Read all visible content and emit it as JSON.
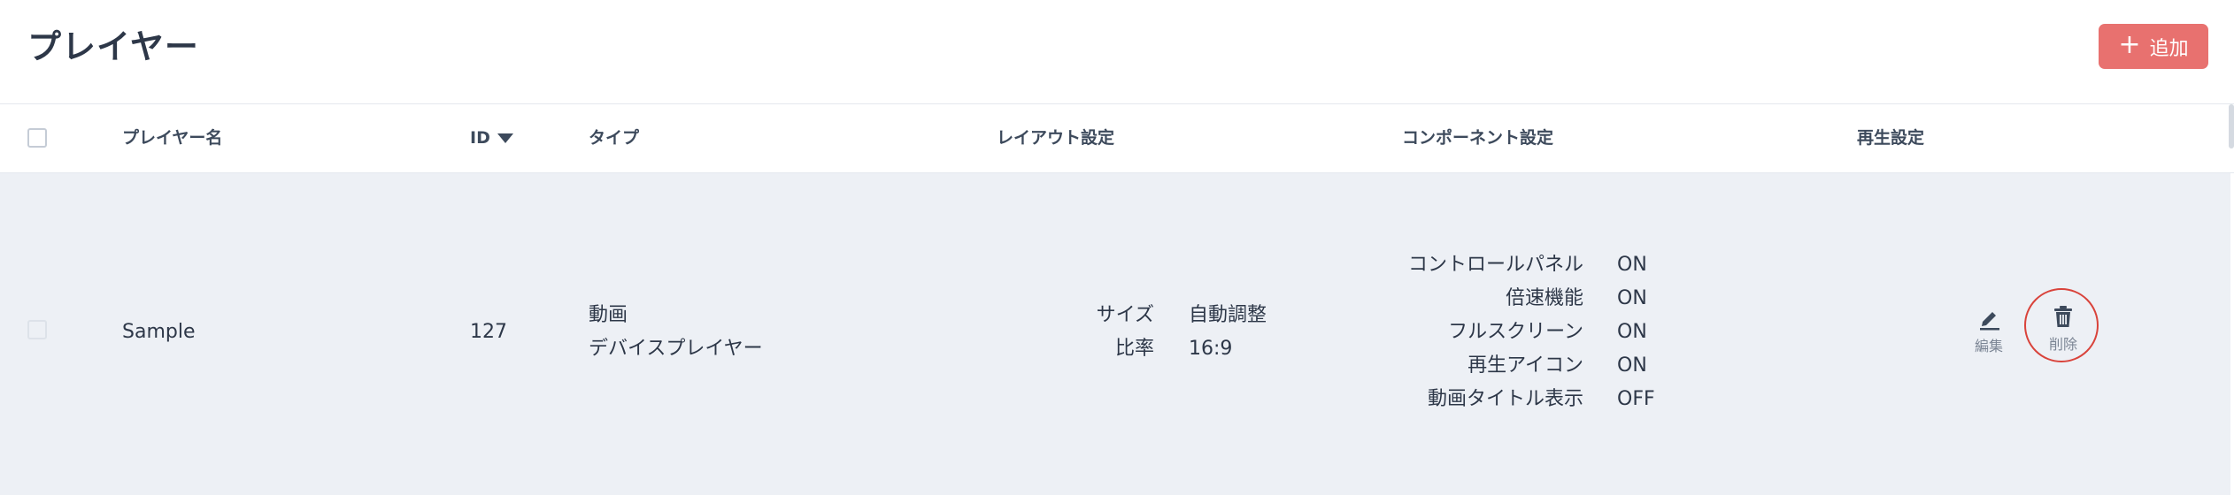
{
  "header": {
    "title": "プレイヤー",
    "add_button_label": "追加"
  },
  "table": {
    "columns": {
      "name": "プレイヤー名",
      "id": "ID",
      "type": "タイプ",
      "layout": "レイアウト設定",
      "component": "コンポーネント設定",
      "playback": "再生設定"
    },
    "sort": {
      "column": "ID",
      "direction": "desc"
    },
    "rows": [
      {
        "name": "Sample",
        "id": "127",
        "type_lines": [
          "動画",
          "デバイスプレイヤー"
        ],
        "layout": [
          {
            "label": "サイズ",
            "value": "自動調整"
          },
          {
            "label": "比率",
            "value": "16:9"
          }
        ],
        "component": [
          {
            "label": "コントロールパネル",
            "value": "ON"
          },
          {
            "label": "倍速機能",
            "value": "ON"
          },
          {
            "label": "フルスクリーン",
            "value": "ON"
          },
          {
            "label": "再生アイコン",
            "value": "ON"
          },
          {
            "label": "動画タイトル表示",
            "value": "OFF"
          }
        ],
        "actions": {
          "edit": "編集",
          "delete": "削除"
        }
      }
    ]
  },
  "icons": {
    "add": "plus-icon",
    "sort": "triangle-down-icon",
    "edit": "pencil-icon",
    "delete": "trash-icon"
  },
  "colors": {
    "accent": "#e8716f",
    "row_background": "#edf0f5",
    "highlight_ring": "#d9433b"
  }
}
